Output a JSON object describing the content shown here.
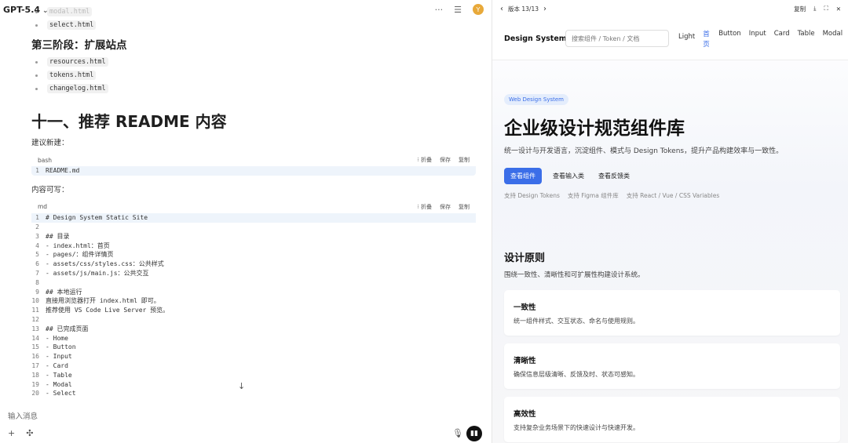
{
  "chat": {
    "model": "GPT-5.4",
    "top_items_before": [
      "modal.html",
      "select.html"
    ],
    "stage3_title": "第三阶段：扩展站点",
    "stage3_items": [
      "resources.html",
      "tokens.html",
      "changelog.html"
    ],
    "section_title": "十一、推荐 README 内容",
    "suggest_new": "建议新建：",
    "bash_block": {
      "lang": "bash",
      "actions": [
        "折叠",
        "保存",
        "复制"
      ],
      "lines": [
        {
          "n": "1",
          "t": "README.md"
        }
      ]
    },
    "content_can": "内容可写：",
    "md_block": {
      "lang": "md",
      "actions": [
        "折叠",
        "保存",
        "复制"
      ],
      "lines": [
        {
          "n": "1",
          "t": "# Design System Static Site"
        },
        {
          "n": "2",
          "t": ""
        },
        {
          "n": "3",
          "t": "## 目录"
        },
        {
          "n": "4",
          "t": "- index.html：首页"
        },
        {
          "n": "5",
          "t": "- pages/：组件详情页"
        },
        {
          "n": "6",
          "t": "- assets/css/styles.css：公共样式"
        },
        {
          "n": "7",
          "t": "- assets/js/main.js：公共交互"
        },
        {
          "n": "8",
          "t": ""
        },
        {
          "n": "9",
          "t": "## 本地运行"
        },
        {
          "n": "10",
          "t": "直接用浏览器打开 index.html 即可。"
        },
        {
          "n": "11",
          "t": "推荐使用 VS Code Live Server 预览。"
        },
        {
          "n": "12",
          "t": ""
        },
        {
          "n": "13",
          "t": "## 已完成页面"
        },
        {
          "n": "14",
          "t": "- Home"
        },
        {
          "n": "15",
          "t": "- Button"
        },
        {
          "n": "16",
          "t": "- Input"
        },
        {
          "n": "17",
          "t": "- Card"
        },
        {
          "n": "18",
          "t": "- Table"
        },
        {
          "n": "19",
          "t": "- Modal"
        },
        {
          "n": "20",
          "t": "- Select"
        }
      ]
    },
    "input_placeholder": "输入消息"
  },
  "preview": {
    "version": "版本 13/13",
    "copy_label": "复制",
    "site": {
      "brand": "Design System",
      "search_placeholder": "搜索组件 / Token / 文档",
      "nav": [
        "Light",
        "首页",
        "Button",
        "Input",
        "Card",
        "Table",
        "Modal"
      ],
      "tag": "Web Design System",
      "hero_title": "企业级设计规范组件库",
      "hero_desc": "统一设计与开发语言，沉淀组件、模式与 Design Tokens，提升产品构建效率与一致性。",
      "buttons": [
        "查看组件",
        "查看输入类",
        "查看反馈类"
      ],
      "supports": [
        "支持 Design Tokens",
        "支持 Figma 组件库",
        "支持 React / Vue / CSS Variables"
      ],
      "principles_title": "设计原则",
      "principles_desc": "围绕一致性、清晰性和可扩展性构建设计系统。",
      "cards": [
        {
          "title": "一致性",
          "desc": "统一组件样式、交互状态、命名与使用规则。"
        },
        {
          "title": "清晰性",
          "desc": "确保信息层级清晰、反馈及时、状态可感知。"
        },
        {
          "title": "高效性",
          "desc": "支持复杂业务场景下的快速设计与快速开发。"
        }
      ]
    }
  }
}
